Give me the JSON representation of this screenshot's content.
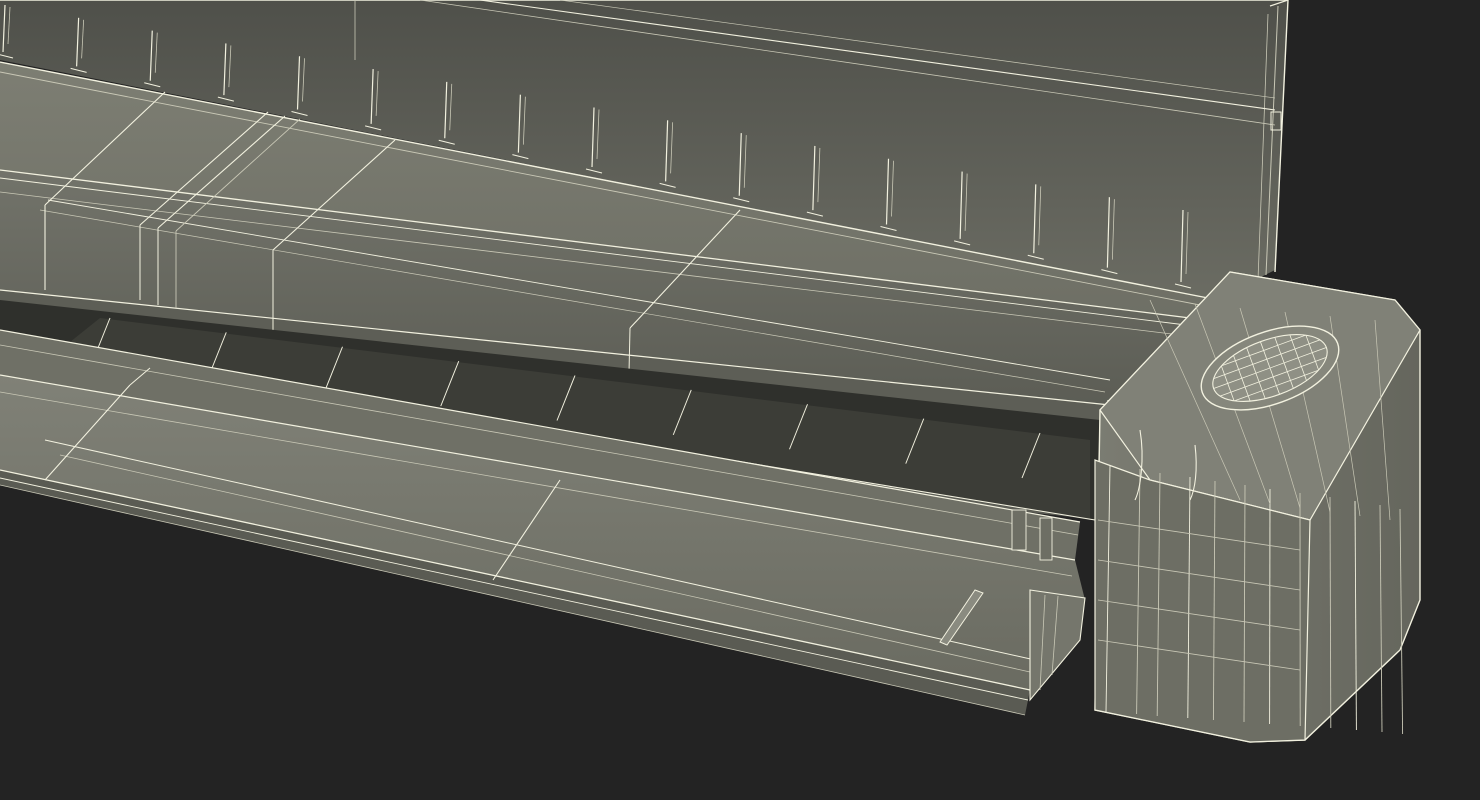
{
  "scene": {
    "subject": "portable-scanner-wireframe-render",
    "colors": {
      "background": "#232323",
      "body_light": "#7c7d72",
      "body_mid": "#6a6b61",
      "body_dark": "#55564d",
      "panel": "#5f6058",
      "slot": "#3a3b35",
      "wire": "#f2f1df",
      "wire_faint": "#c9c8b6"
    },
    "guide_count": 17,
    "feed_tray_segments": 9,
    "button_grid": {
      "rows": 6,
      "cols": 8
    }
  }
}
